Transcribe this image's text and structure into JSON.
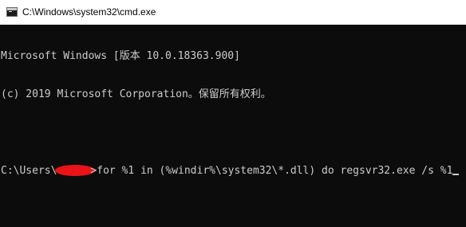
{
  "window": {
    "title": "C:\\Windows\\system32\\cmd.exe",
    "icon": "cmd-console-icon"
  },
  "console": {
    "lines": [
      "Microsoft Windows [版本 10.0.18363.900]",
      "(c) 2019 Microsoft Corporation。保留所有权利。"
    ],
    "prompt_prefix": "C:\\Users\\",
    "prompt_suffix": ">",
    "command": "for %1 in (%windir%\\system32\\*.dll) do regsvr32.exe /s %1",
    "username_redacted": true
  },
  "colors": {
    "console_background": "#0c0c0c",
    "console_text": "#cccccc",
    "titlebar_background": "#ffffff",
    "redaction": "#e8141a"
  }
}
